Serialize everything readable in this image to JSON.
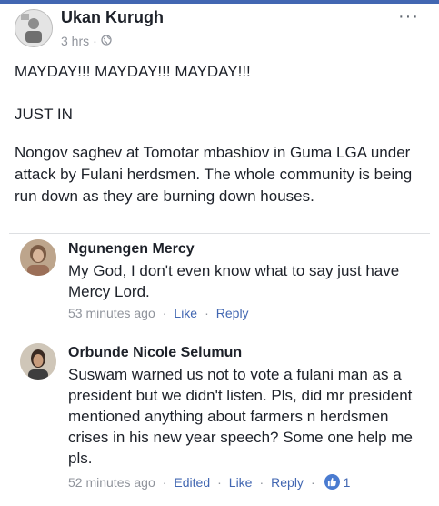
{
  "post": {
    "author": "Ukan Kurugh",
    "time": "3 hrs",
    "time_separator": "·",
    "more_label": "···",
    "lines": [
      "MAYDAY!!! MAYDAY!!! MAYDAY!!!",
      "JUST IN",
      "Nongov saghev at Tomotar mbashiov in Guma LGA under attack by Fulani herdsmen. The whole community is being run down as they are burning down houses."
    ]
  },
  "comments": [
    {
      "name": "Ngunengen Mercy",
      "text": "My God, I don't even know what to say just have Mercy Lord.",
      "time": "53 minutes ago",
      "like_label": "Like",
      "reply_label": "Reply"
    },
    {
      "name": "Orbunde Nicole Selumun",
      "text": "Suswam warned us not to vote a fulani man as a president but we didn't listen.  Pls, did mr president mentioned anything about farmers n herdsmen crises in his new year speech? Some one help me pls.",
      "time": "52 minutes ago",
      "edited_label": "Edited",
      "like_label": "Like",
      "reply_label": "Reply",
      "reaction_count": "1"
    }
  ],
  "icons": {
    "privacy": "globe-icon",
    "reaction": "thumbs-up-icon"
  },
  "colors": {
    "accent": "#4267b2",
    "meta": "#90949c",
    "text": "#1d2129"
  }
}
